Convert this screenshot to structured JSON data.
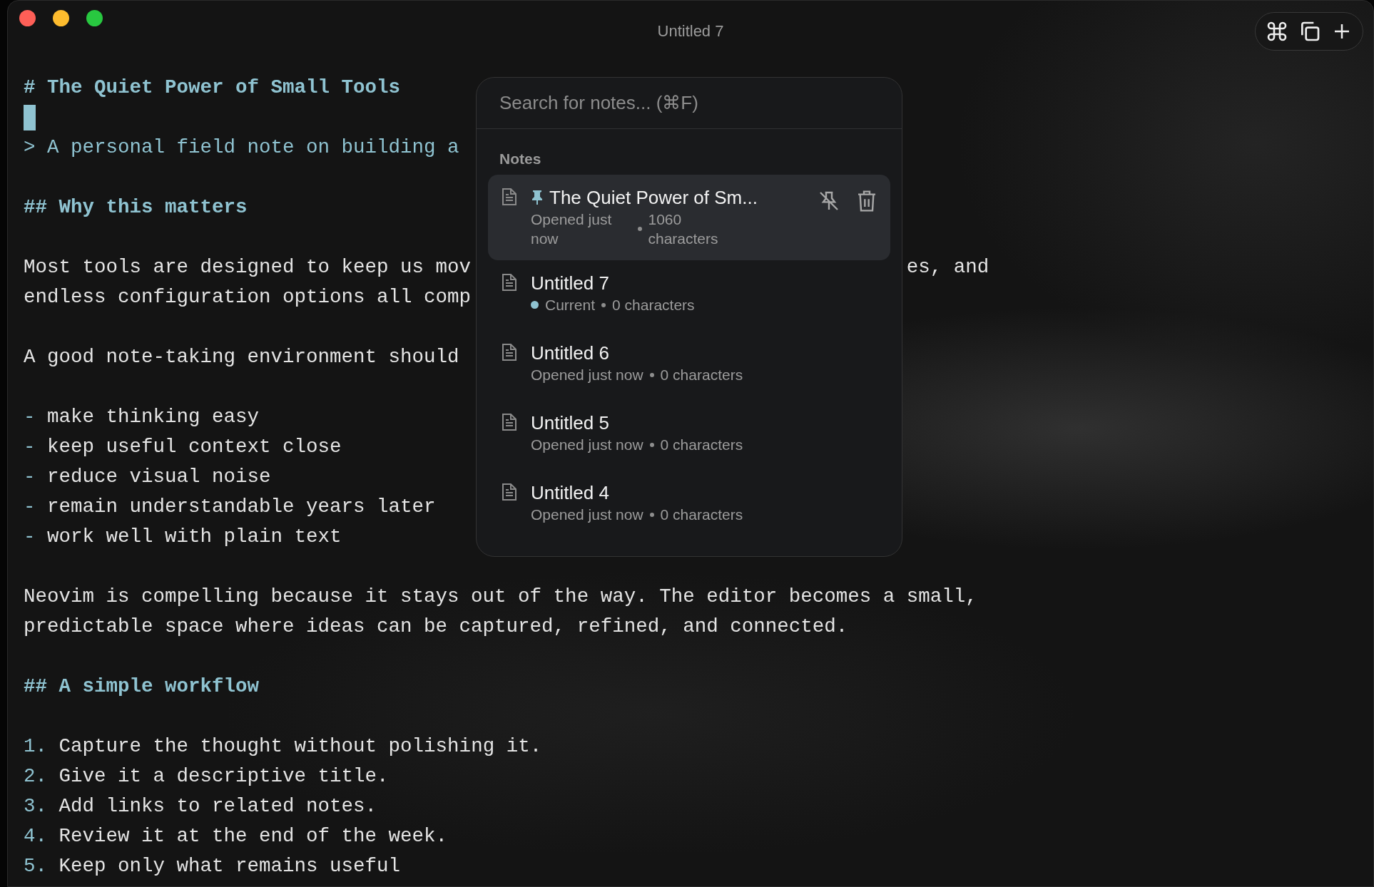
{
  "window": {
    "title": "Untitled 7"
  },
  "editor": {
    "lines": [
      {
        "kind": "heading1",
        "text": "# The Quiet Power of Small Tools"
      },
      {
        "kind": "cursor"
      },
      {
        "kind": "quote",
        "text": "> A personal field note on building a"
      },
      {
        "kind": "blank"
      },
      {
        "kind": "heading2",
        "text": "## Why this matters"
      },
      {
        "kind": "blank"
      },
      {
        "kind": "body",
        "text": "Most tools are designed to keep us mov",
        "right": "es, and"
      },
      {
        "kind": "body",
        "text": "endless configuration options all comp"
      },
      {
        "kind": "blank"
      },
      {
        "kind": "body",
        "text": "A good note-taking environment should"
      },
      {
        "kind": "blank"
      },
      {
        "kind": "list",
        "marker": "-",
        "text": "make thinking easy"
      },
      {
        "kind": "list",
        "marker": "-",
        "text": "keep useful context close"
      },
      {
        "kind": "list",
        "marker": "-",
        "text": "reduce visual noise"
      },
      {
        "kind": "list",
        "marker": "-",
        "text": "remain understandable years later"
      },
      {
        "kind": "list",
        "marker": "-",
        "text": "work well with plain text"
      },
      {
        "kind": "blank"
      },
      {
        "kind": "body",
        "text": "Neovim is compelling because it stays out of the way. The editor becomes a small,"
      },
      {
        "kind": "body",
        "text": "predictable space where ideas can be captured, refined, and connected."
      },
      {
        "kind": "blank"
      },
      {
        "kind": "heading2",
        "text": "## A simple workflow"
      },
      {
        "kind": "blank"
      },
      {
        "kind": "list",
        "marker": "1.",
        "text": "Capture the thought without polishing it."
      },
      {
        "kind": "list",
        "marker": "2.",
        "text": "Give it a descriptive title."
      },
      {
        "kind": "list",
        "marker": "3.",
        "text": "Add links to related notes."
      },
      {
        "kind": "list",
        "marker": "4.",
        "text": "Review it at the end of the week."
      },
      {
        "kind": "list",
        "marker": "5.",
        "text": "Keep only what remains useful"
      }
    ]
  },
  "switcher": {
    "search": {
      "placeholder": "Search for notes... (⌘F)"
    },
    "section": "Notes",
    "notes": [
      {
        "title": "The Quiet Power of Sm...",
        "status": "Opened just now",
        "size": "1060 characters",
        "pinned": true,
        "current": false,
        "selected": true
      },
      {
        "title": "Untitled 7",
        "status": "Current",
        "size": "0 characters",
        "pinned": false,
        "current": true,
        "selected": false
      },
      {
        "title": "Untitled 6",
        "status": "Opened just now",
        "size": "0 characters",
        "pinned": false,
        "current": false,
        "selected": false
      },
      {
        "title": "Untitled 5",
        "status": "Opened just now",
        "size": "0 characters",
        "pinned": false,
        "current": false,
        "selected": false
      },
      {
        "title": "Untitled 4",
        "status": "Opened just now",
        "size": "0 characters",
        "pinned": false,
        "current": false,
        "selected": false
      }
    ]
  }
}
